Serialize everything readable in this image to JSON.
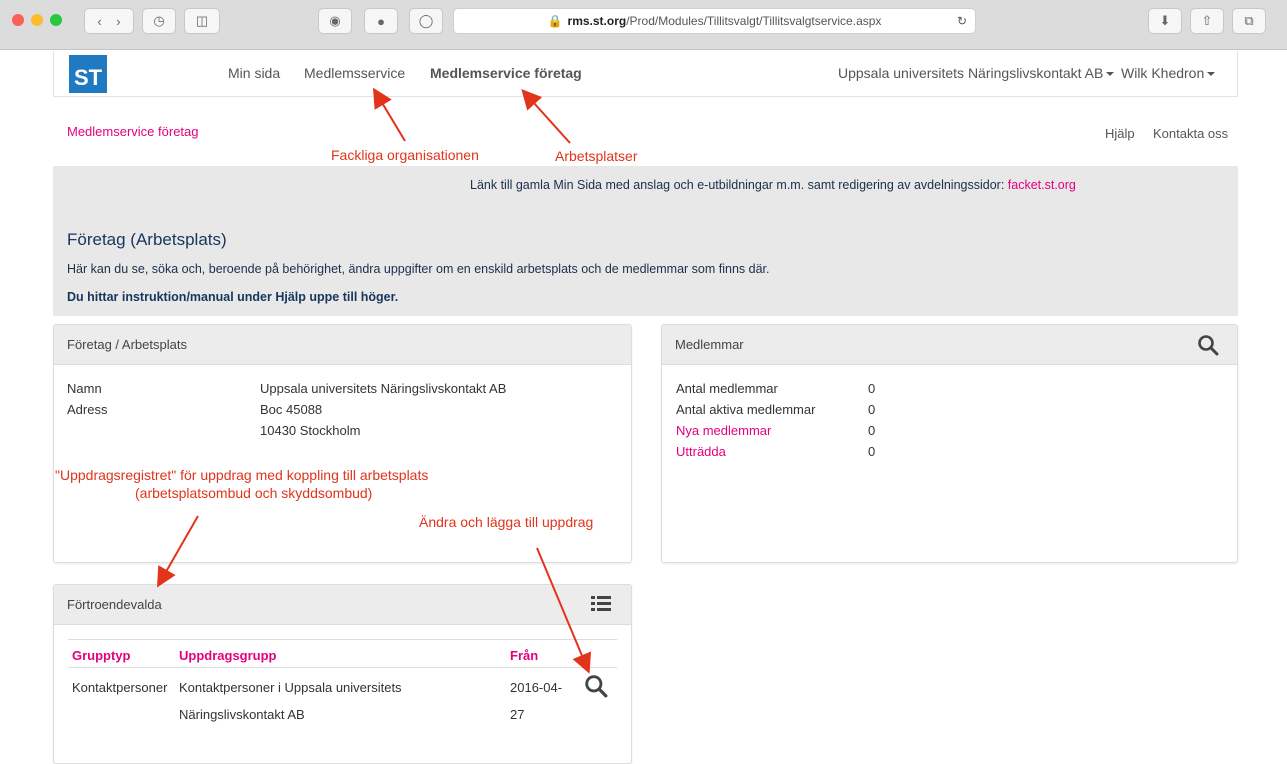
{
  "browser": {
    "url_host": "rms.st.org",
    "url_path": "/Prod/Modules/Tillitsvalgt/Tillitsvalgtservice.aspx"
  },
  "nav": {
    "logo": "ST",
    "items": [
      "Min sida",
      "Medlemsservice",
      "Medlemservice företag"
    ],
    "org_dropdown": "Uppsala universitets Näringslivskontakt AB",
    "user_dropdown": "Wilk Khedron"
  },
  "breadcrumb": "Medlemservice företag",
  "top_links": {
    "help": "Hjälp",
    "contact": "Kontakta oss"
  },
  "annotations": {
    "fackliga": "Fackliga organisationen",
    "arbetsplatser": "Arbetsplatser",
    "uppdrag_1": "\"Uppdragsregistret\" för uppdrag med koppling till arbetsplats",
    "uppdrag_2": "(arbetsplatsombud och skyddsombud)",
    "andra": "Ändra och lägga till uppdrag"
  },
  "banner": {
    "link_text": "Länk till gamla Min Sida med anslag och e-utbildningar m.m. samt redigering av avdelningssidor: ",
    "link_label": "facket.st.org",
    "title": "Företag (Arbetsplats)",
    "description": "Här kan du se, söka och, beroende på behörighet, ändra uppgifter om en enskild arbetsplats och de medlemmar som finns där.",
    "instruction": "Du hittar instruktion/manual under Hjälp uppe till höger."
  },
  "company_panel": {
    "title": "Företag / Arbetsplats",
    "name_label": "Namn",
    "name_value": "Uppsala universitets Näringslivskontakt AB",
    "address_label": "Adress",
    "address_line1": "Boc 45088",
    "address_line2": "10430 Stockholm"
  },
  "members_panel": {
    "title": "Medlemmar",
    "rows": [
      {
        "label": "Antal medlemmar",
        "value": "0"
      },
      {
        "label": "Antal aktiva medlemmar",
        "value": "0"
      },
      {
        "label": "Nya medlemmar",
        "value": "0"
      },
      {
        "label": "Utträdda",
        "value": "0"
      }
    ]
  },
  "trustees_panel": {
    "title": "Förtroendevalda",
    "columns": [
      "Grupptyp",
      "Uppdragsgrupp",
      "Från"
    ],
    "row": {
      "grupptyp": "Kontaktpersoner",
      "uppdragsgrupp_1": "Kontaktpersoner i Uppsala universitets",
      "uppdragsgrupp_2": "Näringslivskontakt AB",
      "fran_1": "2016-04-",
      "fran_2": "27"
    }
  }
}
